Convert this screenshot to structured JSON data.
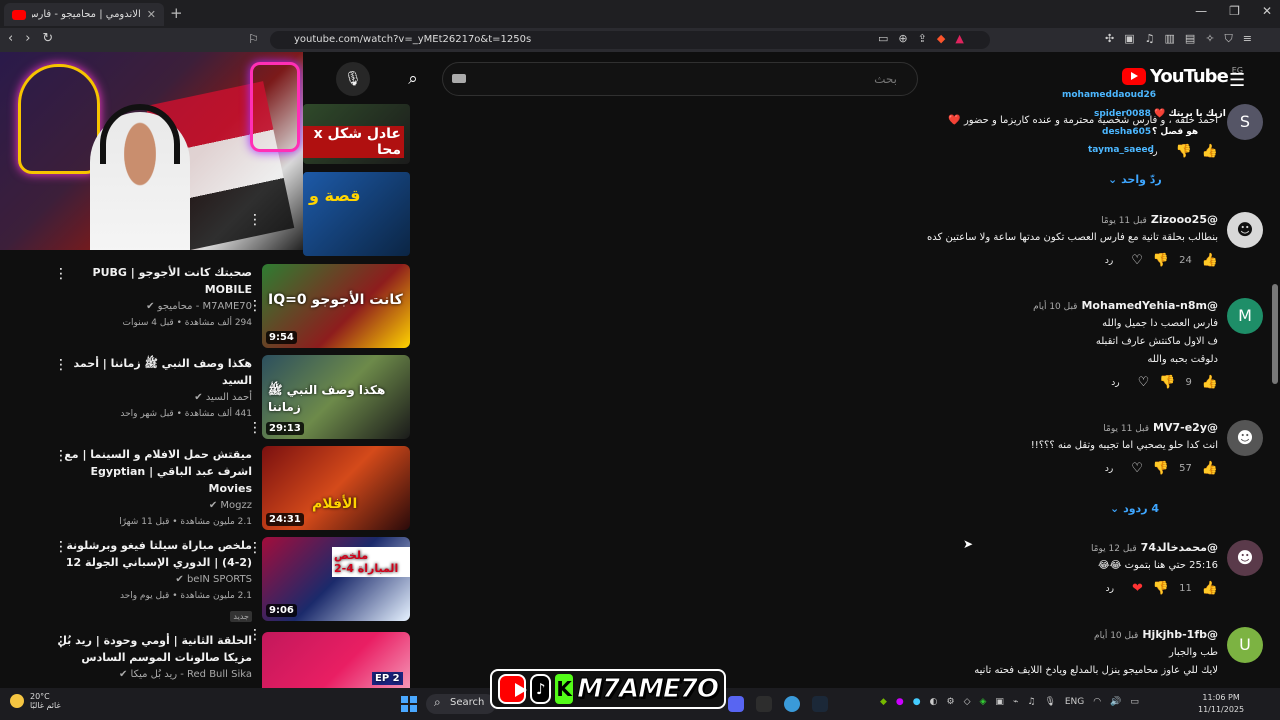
{
  "browser": {
    "tab_title": "الاندومي | محاميجو - فارس العصـ",
    "url": "youtube.com/watch?v=_yMEt26217o&t=1250s"
  },
  "youtube": {
    "search_placeholder": "بحث",
    "logo_text": "YouTube",
    "country_code": "EG"
  },
  "recommended": [
    {
      "title": "صحبتك كانت الأجوجو | PUBG MOBILE",
      "channel": "M7AME70 - محاميجو",
      "views": "294 ألف مشاهدة • قبل 4 سنوات",
      "duration": "9:54",
      "thumb_text": "IQ=0  كانت الأجوجو",
      "badge": ""
    },
    {
      "title": "هكذا وصف النبي ﷺ زماننا | أحمد السيد",
      "channel": "أحمد السيد",
      "views": "441 ألف مشاهدة • قبل شهر واحد",
      "duration": "29:13",
      "thumb_text": "هكذا وصف النبي ﷺ زماننا",
      "badge": ""
    },
    {
      "title": "ميقتش حمل الافلام و السينما | مع اشرف عبد الباقي | Egyptian Movies",
      "channel": "Mogzz",
      "views": "2.1 مليون مشاهدة • قبل 11 شهرًا",
      "duration": "24:31",
      "thumb_text": "الأفلام",
      "badge": ""
    },
    {
      "title": "ملخص مباراة سيلتا فيغو وبرشلونة (2-4) | الدوري الإسباني الجولة 12",
      "channel": "beIN SPORTS",
      "views": "2.1 مليون مشاهدة • قبل يوم واحد",
      "duration": "9:06",
      "thumb_text": "ملخص المباراة 4-2",
      "badge": "جديد"
    },
    {
      "title": "الحلقة الثانية | أومي وحودة | ريد بُل مزيكا صالونات الموسم السادس",
      "channel": "Red Bull Sika - ريد بُل ميكا",
      "views": "",
      "duration": "",
      "thumb_text": "EP 2",
      "badge": ""
    }
  ],
  "top_thumbs": [
    {
      "text": "عادل شكل x محا"
    },
    {
      "text": "قصة و"
    }
  ],
  "partial_comment": {
    "body": "احمد خلقه ، و فارس شخصية محترمة و عنده كاريزما و حضور ❤️",
    "reply_label": "رد",
    "replies": "ردّ واحد",
    "live_users": [
      "mohameddaoud26",
      "spider0088",
      "desha605",
      "tayma_saeed"
    ],
    "live_msgs": [
      "ازيك يا بريتك ❤️",
      "هو فصل ؟"
    ]
  },
  "comments": [
    {
      "author": "@Zizooo25",
      "time": "قبل 11 يومًا",
      "body": "بنطالب بحلقة تانية مع فارس العصب تكون مدتها ساعة ولا ساعتين كده",
      "likes": "24",
      "reply": "رد",
      "avatar": "",
      "avatar_color": "#d8d8d8",
      "replies": ""
    },
    {
      "author": "@MohamedYehia-n8m",
      "time": "قبل 10 أيام",
      "body": "فارس العصب دا جميل والله\nف الاول ماكنتش عارف اتقبله\nدلوقت بحبه والله",
      "likes": "9",
      "reply": "رد",
      "avatar": "M",
      "avatar_color": "#1e8e68",
      "replies": ""
    },
    {
      "author": "@MV7-e2y",
      "time": "قبل 11 يومًا",
      "body": "انت كدا حلو يصحبي اما تجيبه وتقل منه ؟؟؟!!",
      "likes": "57",
      "reply": "رد",
      "avatar": "",
      "avatar_color": "#555",
      "replies": "4 ردود"
    },
    {
      "author": "@محمدخالد74",
      "time": "قبل 12 يومًا",
      "body": "25:16 حتي هنا بتموت 😂😂",
      "timestamp": "25:16",
      "likes": "11",
      "reply": "رد",
      "avatar": "",
      "avatar_color": "#5a3a4a",
      "replies": ""
    },
    {
      "author": "@Hjkjhb-1fb",
      "time": "قبل 10 أيام",
      "body": "طب والجبار\nلايك للي عاوز محاميجو ينزل بالمدلع ويادخ اللايف فحته تانيه",
      "likes": "",
      "reply": "",
      "avatar": "U",
      "avatar_color": "#7cb342",
      "replies": ""
    }
  ],
  "taskbar": {
    "weather_temp": "20°C",
    "weather_desc": "غائم غالبًا",
    "search_label": "Search",
    "lang": "ENG",
    "time": "11:06 PM",
    "date": "11/11/2025"
  },
  "overlay": {
    "brand_name": "M7AME7O",
    "kick_letter": "K"
  }
}
